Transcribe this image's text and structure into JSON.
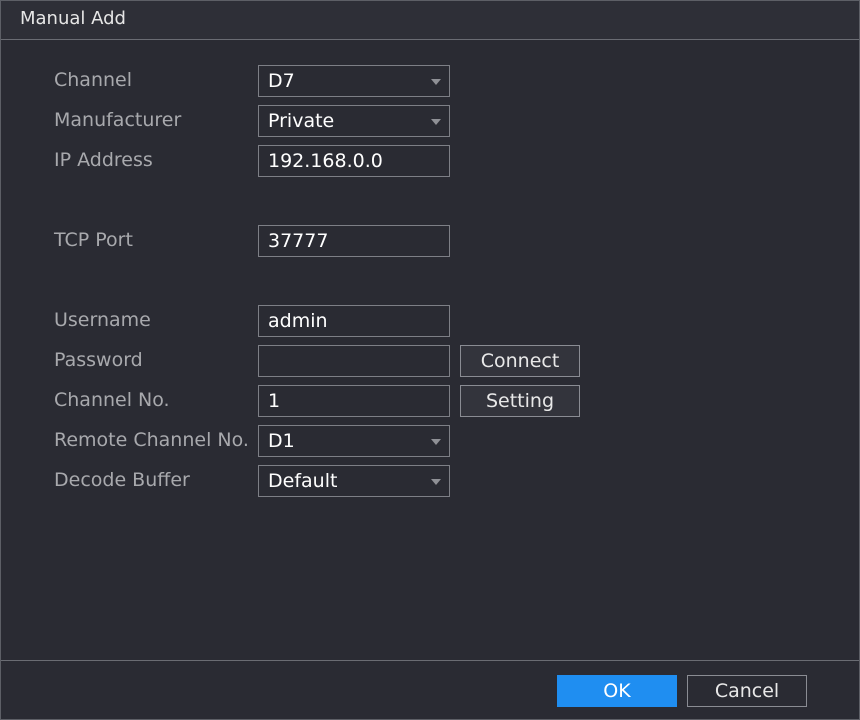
{
  "dialog": {
    "title": "Manual Add"
  },
  "form": {
    "channel": {
      "label": "Channel",
      "value": "D7"
    },
    "manufacturer": {
      "label": "Manufacturer",
      "value": "Private"
    },
    "ip_address": {
      "label": "IP Address",
      "value": "192.168.0.0"
    },
    "tcp_port": {
      "label": "TCP Port",
      "value": "37777"
    },
    "username": {
      "label": "Username",
      "value": "admin"
    },
    "password": {
      "label": "Password",
      "value": ""
    },
    "channel_no": {
      "label": "Channel No.",
      "value": "1"
    },
    "remote_channel_no": {
      "label": "Remote Channel No.",
      "value": "D1"
    },
    "decode_buffer": {
      "label": "Decode Buffer",
      "value": "Default"
    }
  },
  "buttons": {
    "connect": "Connect",
    "setting": "Setting",
    "ok": "OK",
    "cancel": "Cancel"
  },
  "icons": {
    "dropdown": "chevron-down-icon"
  },
  "colors": {
    "background": "#2a2b33",
    "accent": "#1f8ef1",
    "label_text": "#a8a9ad",
    "value_text": "#ffffff",
    "border": "#7d7f86"
  }
}
